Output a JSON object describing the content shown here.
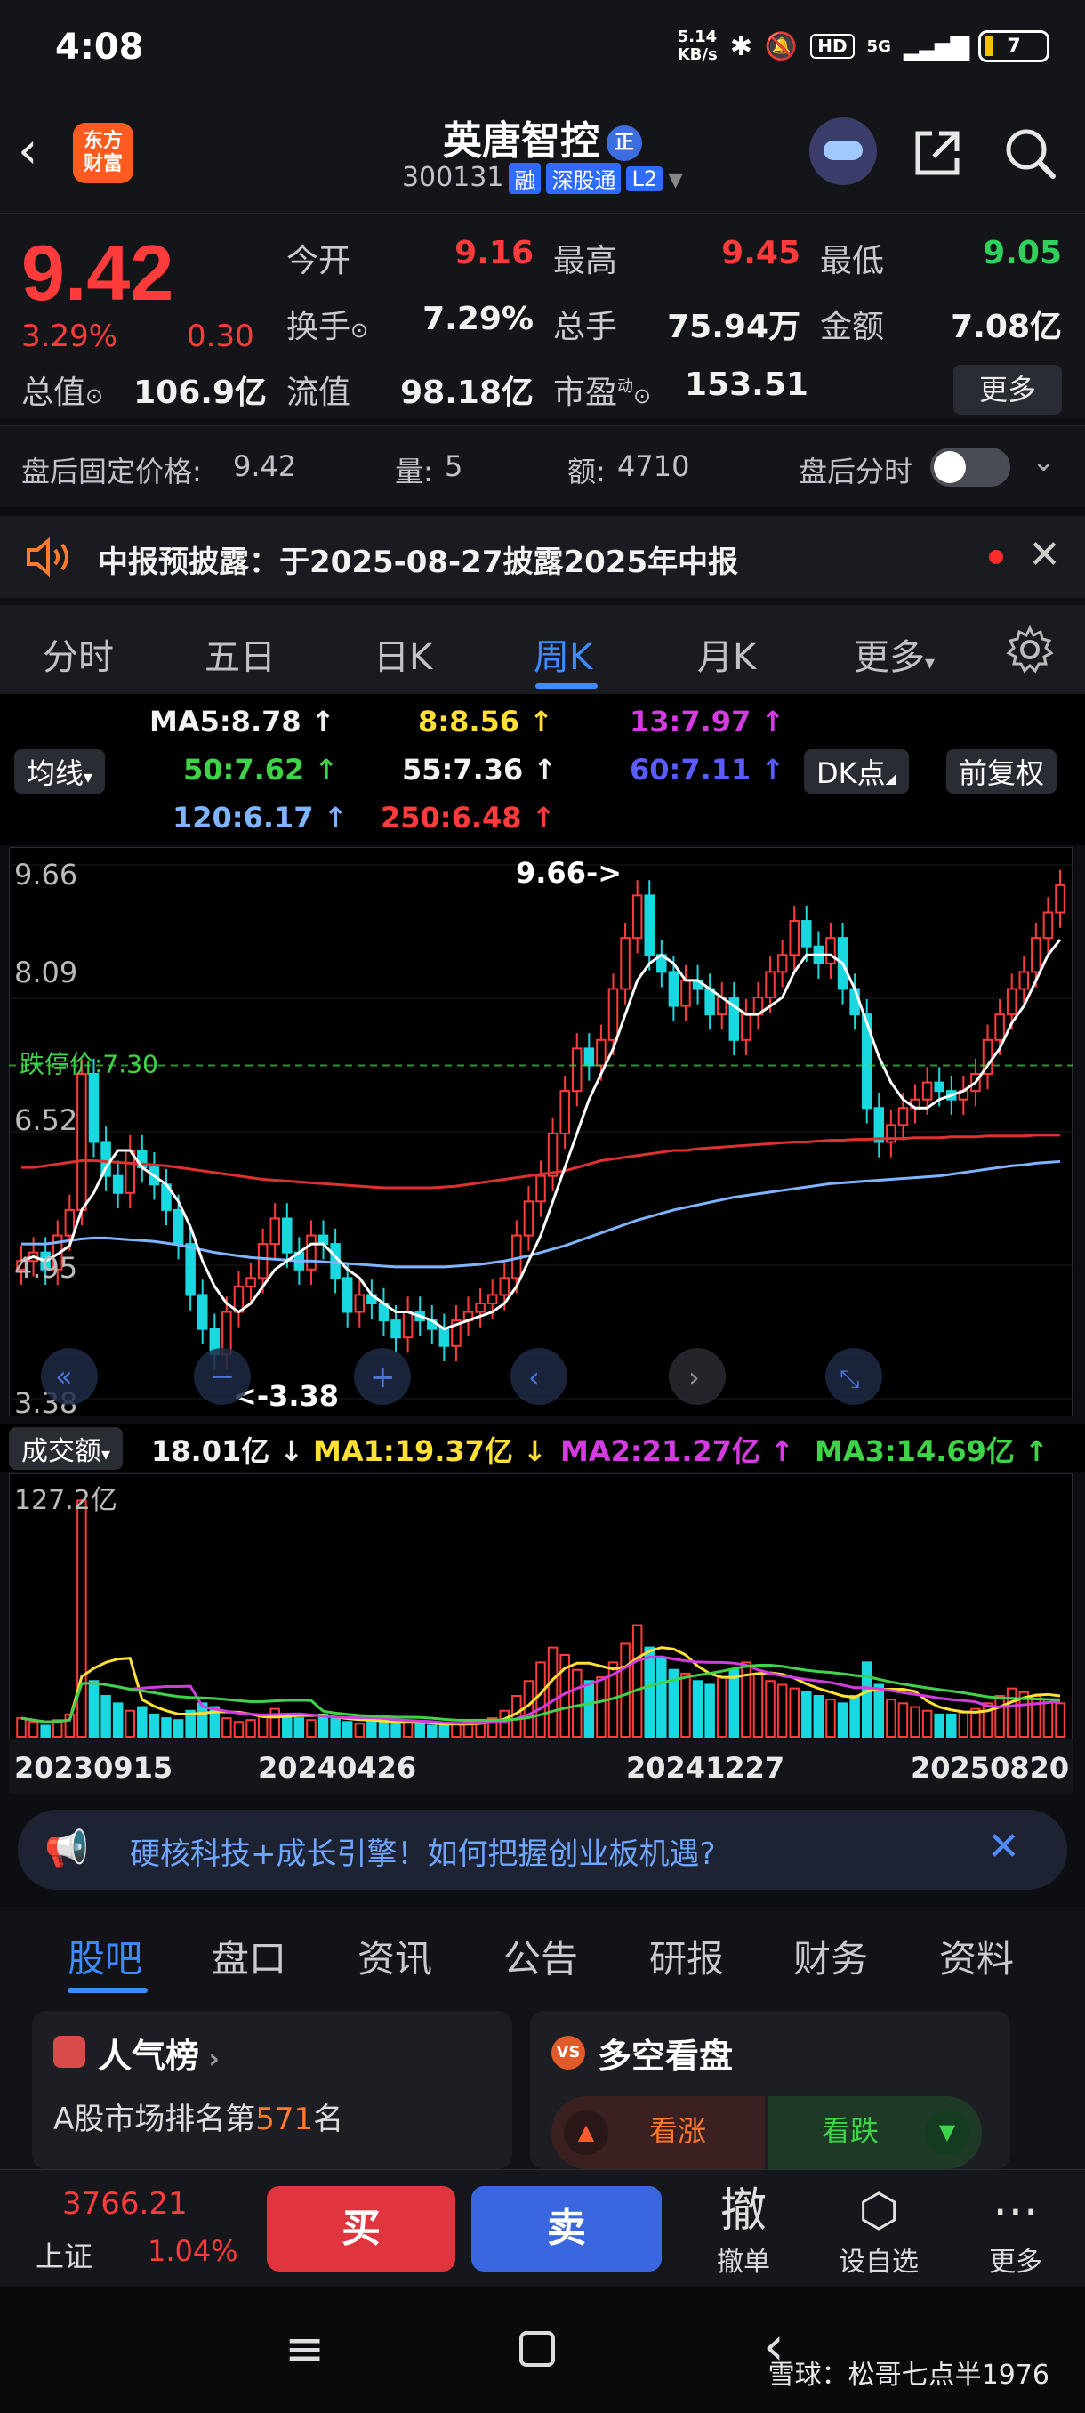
{
  "status": {
    "time": "4:08",
    "speed_top": "5.14",
    "speed_bottom": "KB/s",
    "hd": "HD",
    "net": "5G",
    "battery": "7"
  },
  "header": {
    "logo_line1": "东方",
    "logo_line2": "财富",
    "name": "英唐智控",
    "zheng": "正",
    "code": "300131",
    "tag_rong": "融",
    "tag_market": "深股通",
    "tag_level": "L2"
  },
  "quote": {
    "price": "9.42",
    "pct": "3.29%",
    "change": "0.30",
    "open_label": "今开",
    "open": "9.16",
    "high_label": "最高",
    "high": "9.45",
    "low_label": "最低",
    "low": "9.05",
    "turnover_label": "换手",
    "turnover": "7.29%",
    "volume_label": "总手",
    "volume": "75.94万",
    "amount_label": "金额",
    "amount": "7.08亿",
    "mktcap_label": "总值",
    "mktcap": "106.9亿",
    "float_label": "流值",
    "float": "98.18亿",
    "pe_label": "市盈",
    "pe_sup": "动",
    "pe": "153.51",
    "more": "更多"
  },
  "afterhours": {
    "fixed_label": "盘后固定价格:",
    "fixed": "9.42",
    "qty_label": "量:",
    "qty": "5",
    "amt_label": "额:",
    "amt": "4710",
    "timeshare": "盘后分时"
  },
  "notice": {
    "text": "中报预披露：于2025-08-27披露2025年中报"
  },
  "chart_tabs": [
    "分时",
    "五日",
    "日K",
    "周K",
    "月K",
    "更多"
  ],
  "ma": {
    "ma5": "MA5:8.78",
    "ma8": "8:8.56",
    "ma13": "13:7.97",
    "ma50": "50:7.62",
    "ma55": "55:7.36",
    "ma60": "60:7.11",
    "ma120": "120:6.17",
    "ma250": "250:6.48",
    "junxian": "均线",
    "dk": "DK点",
    "fuquan": "前复权"
  },
  "chart_labels": {
    "y1": "9.66",
    "y2": "8.09",
    "y3": "6.52",
    "y4": "4.95",
    "y5": "3.38",
    "max_note": "9.66->",
    "min_note": "<-3.38",
    "limit": "跌停价:7.30"
  },
  "volume_head": {
    "label": "成交额",
    "val": "18.01亿",
    "ma1": "MA1:19.37亿",
    "ma2": "MA2:21.27亿",
    "ma3": "MA3:14.69亿"
  },
  "volume_labels": {
    "top": "127.2亿",
    "d1": "20230915",
    "d2": "20240426",
    "d3": "20241227",
    "d4": "20250820"
  },
  "promo": {
    "text": "硬核科技+成长引擎！如何把握创业板机遇?"
  },
  "bottom_tabs": [
    "股吧",
    "盘口",
    "资讯",
    "公告",
    "研报",
    "财务",
    "资料"
  ],
  "cards": {
    "popular": "人气榜",
    "rank_pre": "A股市场排名第",
    "rank": "571",
    "rank_post": "名",
    "bullbear": "多空看盘",
    "up": "看涨",
    "down": "看跌"
  },
  "tradebar": {
    "index": "3766.21",
    "index_name": "上证",
    "index_pct": "1.04%",
    "buy": "买",
    "sell": "卖",
    "cancel_icon": "撤",
    "cancel": "撤单",
    "setwatch": "设自选",
    "more": "更多"
  },
  "watermark": "雪球：松哥七点半1976",
  "chart_data": {
    "type": "candlestick",
    "x_ticks": [
      "20230915",
      "20240426",
      "20241227",
      "20250820"
    ],
    "ylim": [
      3.38,
      9.66
    ],
    "y_ticks": [
      9.66,
      8.09,
      6.52,
      4.95,
      3.38
    ],
    "high_mark": 9.66,
    "low_mark": 3.38,
    "limit_down": 7.3,
    "close": [
      5.0,
      5.1,
      4.9,
      5.3,
      5.6,
      7.2,
      6.4,
      6.0,
      5.8,
      6.3,
      6.1,
      5.9,
      5.6,
      5.2,
      4.6,
      4.2,
      3.9,
      4.4,
      4.7,
      4.8,
      5.2,
      5.5,
      5.1,
      4.9,
      5.3,
      5.2,
      4.8,
      4.4,
      4.6,
      4.5,
      4.3,
      4.1,
      4.4,
      4.3,
      4.2,
      4.0,
      4.3,
      4.4,
      4.5,
      4.6,
      4.8,
      5.3,
      5.7,
      6.0,
      6.5,
      7.0,
      7.5,
      7.3,
      7.6,
      8.2,
      8.8,
      9.3,
      8.6,
      8.4,
      8.0,
      8.3,
      8.2,
      7.9,
      8.1,
      7.6,
      7.9,
      8.1,
      8.4,
      8.6,
      9.0,
      8.7,
      8.5,
      8.8,
      8.2,
      7.9,
      6.8,
      6.4,
      6.6,
      6.8,
      6.9,
      7.1,
      7.0,
      6.9,
      7.0,
      7.2,
      7.6,
      7.9,
      8.2,
      8.4,
      8.8,
      9.1,
      9.42
    ],
    "ma5": [
      5.0,
      5.05,
      5.0,
      5.08,
      5.18,
      5.6,
      5.8,
      6.1,
      6.3,
      6.3,
      6.1,
      6.0,
      5.9,
      5.7,
      5.4,
      5.0,
      4.7,
      4.5,
      4.4,
      4.5,
      4.7,
      4.9,
      5.0,
      5.1,
      5.2,
      5.2,
      5.05,
      4.9,
      4.8,
      4.6,
      4.5,
      4.4,
      4.4,
      4.35,
      4.3,
      4.2,
      4.25,
      4.3,
      4.35,
      4.4,
      4.5,
      4.7,
      5.0,
      5.3,
      5.7,
      6.1,
      6.5,
      6.9,
      7.2,
      7.5,
      7.9,
      8.3,
      8.5,
      8.6,
      8.5,
      8.3,
      8.3,
      8.2,
      8.1,
      8.0,
      7.9,
      7.9,
      8.0,
      8.1,
      8.4,
      8.6,
      8.6,
      8.6,
      8.5,
      8.2,
      7.8,
      7.4,
      7.1,
      6.9,
      6.8,
      6.8,
      6.9,
      6.95,
      7.0,
      7.1,
      7.3,
      7.5,
      7.8,
      8.0,
      8.3,
      8.6,
      8.78
    ],
    "ma250": [
      6.1,
      6.1,
      6.12,
      6.14,
      6.16,
      6.18,
      6.18,
      6.17,
      6.16,
      6.15,
      6.14,
      6.13,
      6.12,
      6.1,
      6.08,
      6.06,
      6.04,
      6.02,
      6.0,
      5.98,
      5.96,
      5.95,
      5.94,
      5.93,
      5.92,
      5.91,
      5.9,
      5.89,
      5.88,
      5.87,
      5.86,
      5.86,
      5.86,
      5.86,
      5.86,
      5.87,
      5.88,
      5.9,
      5.92,
      5.94,
      5.96,
      5.98,
      6.0,
      6.02,
      6.04,
      6.06,
      6.1,
      6.14,
      6.18,
      6.2,
      6.22,
      6.24,
      6.26,
      6.28,
      6.3,
      6.3,
      6.32,
      6.33,
      6.34,
      6.35,
      6.36,
      6.37,
      6.38,
      6.39,
      6.4,
      6.4,
      6.41,
      6.42,
      6.42,
      6.43,
      6.43,
      6.44,
      6.44,
      6.44,
      6.45,
      6.45,
      6.45,
      6.46,
      6.46,
      6.46,
      6.47,
      6.47,
      6.47,
      6.47,
      6.48,
      6.48,
      6.48
    ],
    "ma120": [
      5.2,
      5.2,
      5.2,
      5.22,
      5.24,
      5.26,
      5.27,
      5.27,
      5.26,
      5.25,
      5.24,
      5.23,
      5.21,
      5.19,
      5.16,
      5.13,
      5.1,
      5.08,
      5.06,
      5.04,
      5.03,
      5.02,
      5.01,
      5.0,
      5.0,
      4.99,
      4.98,
      4.97,
      4.96,
      4.95,
      4.94,
      4.93,
      4.93,
      4.93,
      4.93,
      4.93,
      4.94,
      4.95,
      4.96,
      4.98,
      5.0,
      5.03,
      5.06,
      5.1,
      5.14,
      5.18,
      5.23,
      5.28,
      5.33,
      5.38,
      5.43,
      5.48,
      5.52,
      5.56,
      5.6,
      5.63,
      5.66,
      5.69,
      5.72,
      5.75,
      5.77,
      5.79,
      5.81,
      5.83,
      5.85,
      5.87,
      5.89,
      5.91,
      5.92,
      5.93,
      5.94,
      5.95,
      5.96,
      5.97,
      5.98,
      5.99,
      6.0,
      6.02,
      6.04,
      6.06,
      6.08,
      6.1,
      6.12,
      6.13,
      6.15,
      6.16,
      6.17
    ],
    "volume_unit": "亿",
    "volume_max": 127.2,
    "volume_last": 18.01,
    "volume": [
      10,
      8,
      6,
      9,
      12,
      127,
      30,
      22,
      18,
      14,
      16,
      12,
      10,
      9,
      14,
      18,
      16,
      10,
      8,
      9,
      11,
      15,
      12,
      10,
      9,
      12,
      10,
      8,
      7,
      8,
      9,
      7,
      8,
      7,
      6,
      6,
      7,
      8,
      9,
      10,
      14,
      22,
      30,
      40,
      48,
      44,
      36,
      30,
      32,
      40,
      50,
      60,
      48,
      42,
      36,
      34,
      30,
      28,
      32,
      36,
      40,
      34,
      30,
      28,
      26,
      24,
      22,
      20,
      18,
      22,
      40,
      28,
      20,
      18,
      16,
      14,
      12,
      12,
      13,
      15,
      18,
      22,
      26,
      24,
      22,
      20,
      18
    ]
  }
}
